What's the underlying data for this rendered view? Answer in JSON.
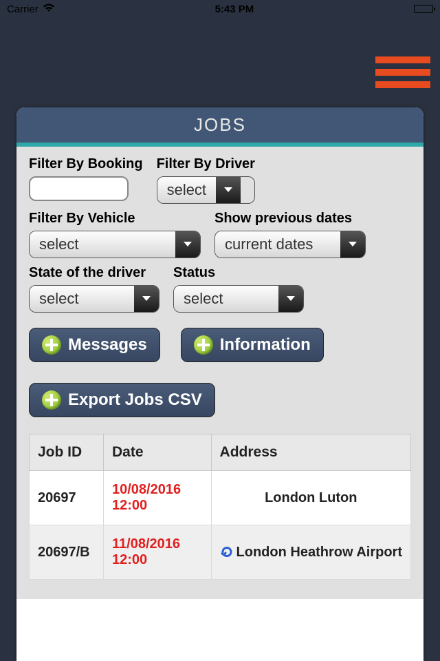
{
  "status": {
    "carrier": "Carrier",
    "time": "5:43 PM"
  },
  "panel": {
    "title": "JOBS"
  },
  "filters": {
    "booking": {
      "label": "Filter By Booking",
      "value": ""
    },
    "driver": {
      "label": "Filter By Driver",
      "value": "select"
    },
    "vehicle": {
      "label": "Filter By Vehicle",
      "value": "select"
    },
    "prevdates": {
      "label": "Show previous dates",
      "value": "current dates"
    },
    "driverstate": {
      "label": "State of the driver",
      "value": "select"
    },
    "status": {
      "label": "Status",
      "value": "select"
    }
  },
  "buttons": {
    "messages": "Messages",
    "information": "Information",
    "export": "Export Jobs CSV"
  },
  "table": {
    "headers": {
      "jobid": "Job ID",
      "date": "Date",
      "address": "Address"
    },
    "rows": [
      {
        "jobid": "20697",
        "date": "10/08/2016 12:00",
        "address": "London Luton",
        "return": false
      },
      {
        "jobid": "20697/B",
        "date": "11/08/2016 12:00",
        "address": "London Heathrow Airport",
        "return": true
      }
    ]
  }
}
